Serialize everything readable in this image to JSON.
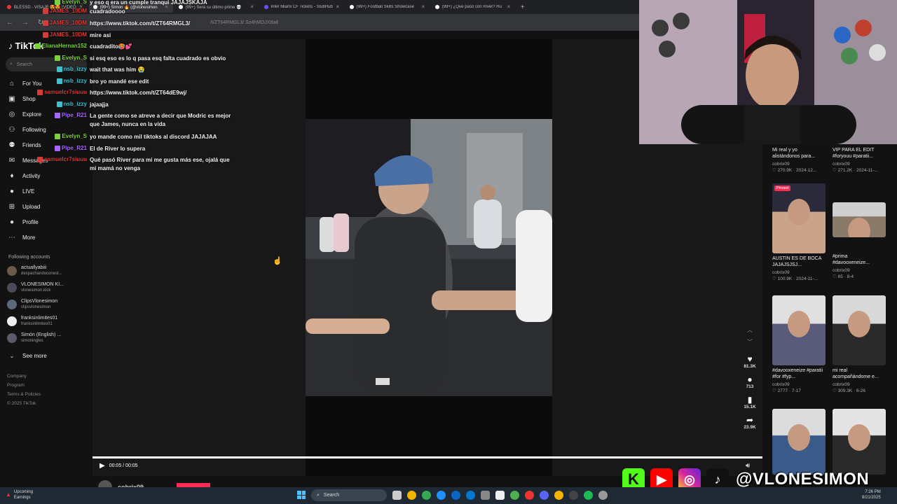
{
  "browser": {
    "tabs": [
      {
        "title": "BLESSD - VISAJE 😍😍 (VIDEO",
        "color": "#e33",
        "active": false
      },
      {
        "title": "(99+) Simon 🔥 (@vlonesimon",
        "color": "#ffffff",
        "active": true
      },
      {
        "title": "(99+) Será su último prime 💀",
        "color": "#ffffff",
        "active": false
      },
      {
        "title": "Inter Miami CF Tickets - StubHub",
        "color": "#6f4cff",
        "active": false
      },
      {
        "title": "(99+) Football Skills Showcase",
        "color": "#ffffff",
        "active": false
      },
      {
        "title": "(99+) ¿Qué pasó con River? Hu",
        "color": "#ffffff",
        "active": false
      }
    ],
    "new_tab": "+",
    "url": "/t/ZT64RMGL3/ Sz4hMOJX8a8"
  },
  "tiktok": {
    "logo": "TikTok",
    "search_placeholder": "Search",
    "nav": [
      {
        "label": "For You",
        "icon": "home-icon",
        "glyph": "⌂"
      },
      {
        "label": "Shop",
        "icon": "shop-icon",
        "glyph": "▣"
      },
      {
        "label": "Explore",
        "icon": "compass-icon",
        "glyph": "◎"
      },
      {
        "label": "Following",
        "icon": "following-icon",
        "glyph": "⚇"
      },
      {
        "label": "Friends",
        "icon": "friends-icon",
        "glyph": "⚉"
      },
      {
        "label": "Messages",
        "icon": "messages-icon",
        "glyph": "✉"
      },
      {
        "label": "Activity",
        "icon": "activity-icon",
        "glyph": "♦"
      },
      {
        "label": "LIVE",
        "icon": "live-icon",
        "glyph": "●"
      },
      {
        "label": "Upload",
        "icon": "upload-icon",
        "glyph": "⊞"
      },
      {
        "label": "Profile",
        "icon": "profile-icon",
        "glyph": "●"
      },
      {
        "label": "More",
        "icon": "more-icon",
        "glyph": "⋯"
      }
    ],
    "following_heading": "Following accounts",
    "following": [
      {
        "name": "actuallyabiii",
        "sub": "despachandoconest..."
      },
      {
        "name": "VLONESIMON KI...",
        "sub": "vlonesimon.kick"
      },
      {
        "name": "ClipsVlonesimon",
        "sub": "clipsvlonesimon"
      },
      {
        "name": "franksinlimites01",
        "sub": "franksinlimites01"
      },
      {
        "name": "Simón (English) ...",
        "sub": "simoningles"
      }
    ],
    "see_more": "See more",
    "footer": [
      "Company",
      "Program",
      "Terms & Policies",
      "© 2025 TikTok"
    ],
    "player": {
      "time": "00:05 / 00:05",
      "progress": 1.0,
      "creator": "cobrix09"
    },
    "actions": [
      {
        "icon": "heart-icon",
        "glyph": "♥",
        "count": "81.3K"
      },
      {
        "icon": "comment-icon",
        "glyph": "●",
        "count": "713"
      },
      {
        "icon": "bookmark-icon",
        "glyph": "▮",
        "count": "15.1K"
      },
      {
        "icon": "share-icon",
        "glyph": "➦",
        "count": "23.9K"
      }
    ],
    "grid": [
      {
        "caption": "Mi real y yo alistándonos para...",
        "user": "cobrix09",
        "meta": "♡ 270.9K · 2024-12...",
        "pinned": false
      },
      {
        "caption": "VIP PARA EL EDIT #foryouu #paratii...",
        "user": "cobrix09",
        "meta": "♡ 271.2K · 2024-11-...",
        "pinned": false
      },
      {
        "caption": "AUSTIN ES DE BOCA JAJAJSJSJ...",
        "user": "cobrix09",
        "meta": "♡ 100.9K · 2024-11-...",
        "pinned": true
      },
      {
        "caption": "#prima #davooxeneize...",
        "user": "cobrix09",
        "meta": "♡ 65 · 8-4",
        "pinned": false
      },
      {
        "caption": "#davooxeneize #paratii #for #fyp...",
        "user": "cobrix09",
        "meta": "♡ 2777 · 7-17",
        "pinned": false
      },
      {
        "caption": "mi real acompañándome e...",
        "user": "cobrix09",
        "meta": "♡ 309.3K · 6-26",
        "pinned": false
      },
      {
        "caption": "",
        "user": "",
        "meta": "",
        "pinned": false
      },
      {
        "caption": "",
        "user": "",
        "meta": "",
        "pinned": false
      }
    ],
    "pinned_label": "Pinned"
  },
  "chat": [
    {
      "user": "Evelyn_S",
      "color": "#7ad13d",
      "msg": "y eso q era un cumple tranqui JAJAJSKAJA"
    },
    {
      "user": "JAMES_10DM",
      "color": "#d83a3a",
      "msg": "cuadradoooo"
    },
    {
      "user": "JAMES_10DM",
      "color": "#d83a3a",
      "msg": "https://www.tiktok.com/t/ZT64RMGL3/"
    },
    {
      "user": "JAMES_10DM",
      "color": "#d83a3a",
      "msg": "mire asi"
    },
    {
      "user": "ElianaHernan152",
      "color": "#7ad13d",
      "msg": "cuadradito🥵💕"
    },
    {
      "user": "Evelyn_S",
      "color": "#7ad13d",
      "msg": "si esq eso es lo q pasa esq falta cuadrado es obvio"
    },
    {
      "user": "nsb_izzy",
      "color": "#3dc0d1",
      "msg": "wait that was him 😭"
    },
    {
      "user": "nsb_izzy",
      "color": "#3dc0d1",
      "msg": "bro yo mandé ese edit"
    },
    {
      "user": "samuelcr7siuuu",
      "color": "#d83a3a",
      "msg": "https://www.tiktok.com/t/ZT64dE9wj/"
    },
    {
      "user": "nsb_izzy",
      "color": "#3dc0d1",
      "msg": "jajaajja"
    },
    {
      "user": "Pipe_R21",
      "color": "#a866ff",
      "msg": "La gente como se atreve a decir que Modric es mejor que James, nunca en la vida"
    },
    {
      "user": "Evelyn_S",
      "color": "#7ad13d",
      "msg": "yo mande como mil tiktoks al discord JAJAJAA"
    },
    {
      "user": "Pipe_R21",
      "color": "#a866ff",
      "msg": "El de River lo supera"
    },
    {
      "user": "samuelcr7siuuu",
      "color": "#d83a3a",
      "msg": "Qué pasó River para mí me gusta más ese, ojalá que mi mamá no venga"
    }
  ],
  "overlay": {
    "handle": "@VLONESIMON",
    "kick_letter": "K",
    "colors": {
      "kick": "#53fc18",
      "youtube": "#ff0000",
      "instagram": "#d6249f",
      "tiktok": "#111111"
    }
  },
  "taskbar": {
    "weather_title": "Upcoming",
    "weather_sub": "Earnings",
    "search": "Search",
    "time": "7:26 PM",
    "date": "8/21/2025"
  }
}
